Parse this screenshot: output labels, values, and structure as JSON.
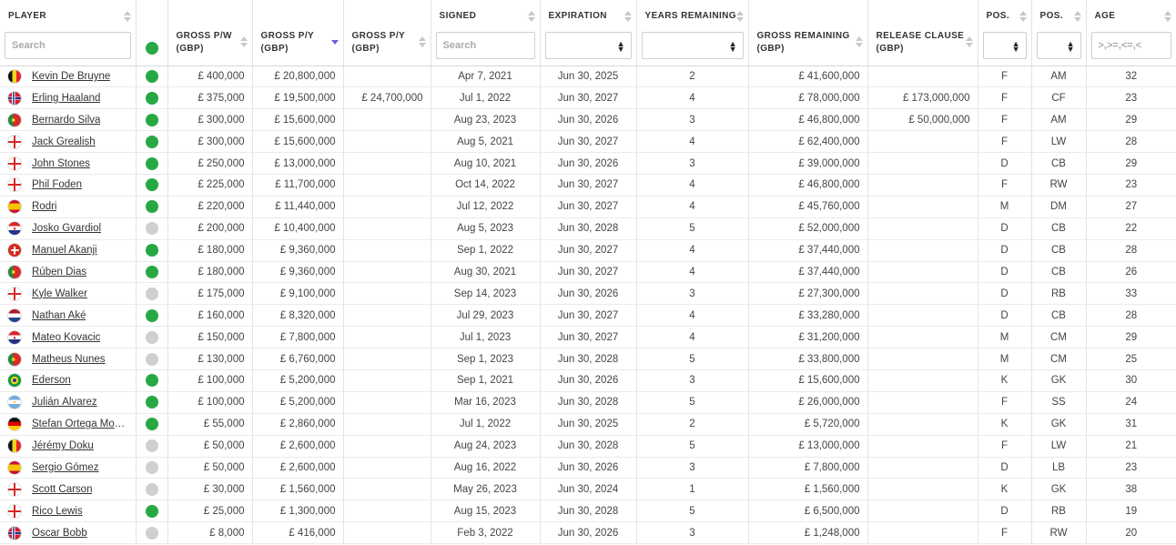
{
  "columns": {
    "player": "PLAYER",
    "gross_pw": "GROSS P/W\n(GBP)",
    "gross_py": "GROSS P/Y\n(GBP)",
    "gross_py2": "GROSS P/Y\n(GBP)",
    "signed": "SIGNED",
    "expiration": "EXPIRATION",
    "years_remaining": "YEARS REMAINING",
    "gross_remaining": "GROSS REMAINING\n(GBP)",
    "release_clause": "RELEASE CLAUSE\n(GBP)",
    "pos1": "POS.",
    "pos2": "POS.",
    "age": "AGE"
  },
  "filters": {
    "player_placeholder": "Search",
    "signed_placeholder": "Search",
    "age_placeholder": ">,>=,<=,<"
  },
  "colors": {
    "active_check": "#27a844",
    "inactive_check": "#cfcfcf",
    "sort_active": "#6d5fd6"
  },
  "sort": {
    "column": "gross_py",
    "direction": "descending"
  },
  "rows": [
    {
      "name": "Kevin De Bruyne",
      "flag": "belgium",
      "active": true,
      "pw": "£ 400,000",
      "py": "£ 20,800,000",
      "py2": "",
      "signed": "Apr 7, 2021",
      "exp": "Jun 30, 2025",
      "yrs": "2",
      "rem": "£ 41,600,000",
      "rc": "",
      "p1": "F",
      "p2": "AM",
      "age": "32"
    },
    {
      "name": "Erling Haaland",
      "flag": "norway",
      "active": true,
      "pw": "£ 375,000",
      "py": "£ 19,500,000",
      "py2": "£ 24,700,000",
      "signed": "Jul 1, 2022",
      "exp": "Jun 30, 2027",
      "yrs": "4",
      "rem": "£ 78,000,000",
      "rc": "£ 173,000,000",
      "p1": "F",
      "p2": "CF",
      "age": "23"
    },
    {
      "name": "Bernardo Silva",
      "flag": "portugal",
      "active": true,
      "pw": "£ 300,000",
      "py": "£ 15,600,000",
      "py2": "",
      "signed": "Aug 23, 2023",
      "exp": "Jun 30, 2026",
      "yrs": "3",
      "rem": "£ 46,800,000",
      "rc": "£ 50,000,000",
      "p1": "F",
      "p2": "AM",
      "age": "29"
    },
    {
      "name": "Jack Grealish",
      "flag": "england",
      "active": true,
      "pw": "£ 300,000",
      "py": "£ 15,600,000",
      "py2": "",
      "signed": "Aug 5, 2021",
      "exp": "Jun 30, 2027",
      "yrs": "4",
      "rem": "£ 62,400,000",
      "rc": "",
      "p1": "F",
      "p2": "LW",
      "age": "28"
    },
    {
      "name": "John Stones",
      "flag": "england",
      "active": true,
      "pw": "£ 250,000",
      "py": "£ 13,000,000",
      "py2": "",
      "signed": "Aug 10, 2021",
      "exp": "Jun 30, 2026",
      "yrs": "3",
      "rem": "£ 39,000,000",
      "rc": "",
      "p1": "D",
      "p2": "CB",
      "age": "29"
    },
    {
      "name": "Phil Foden",
      "flag": "england",
      "active": true,
      "pw": "£ 225,000",
      "py": "£ 11,700,000",
      "py2": "",
      "signed": "Oct 14, 2022",
      "exp": "Jun 30, 2027",
      "yrs": "4",
      "rem": "£ 46,800,000",
      "rc": "",
      "p1": "F",
      "p2": "RW",
      "age": "23"
    },
    {
      "name": "Rodri",
      "flag": "spain",
      "active": true,
      "pw": "£ 220,000",
      "py": "£ 11,440,000",
      "py2": "",
      "signed": "Jul 12, 2022",
      "exp": "Jun 30, 2027",
      "yrs": "4",
      "rem": "£ 45,760,000",
      "rc": "",
      "p1": "M",
      "p2": "DM",
      "age": "27"
    },
    {
      "name": "Josko Gvardiol",
      "flag": "croatia",
      "active": false,
      "pw": "£ 200,000",
      "py": "£ 10,400,000",
      "py2": "",
      "signed": "Aug 5, 2023",
      "exp": "Jun 30, 2028",
      "yrs": "5",
      "rem": "£ 52,000,000",
      "rc": "",
      "p1": "D",
      "p2": "CB",
      "age": "22"
    },
    {
      "name": "Manuel Akanji",
      "flag": "switzerland",
      "active": true,
      "pw": "£ 180,000",
      "py": "£ 9,360,000",
      "py2": "",
      "signed": "Sep 1, 2022",
      "exp": "Jun 30, 2027",
      "yrs": "4",
      "rem": "£ 37,440,000",
      "rc": "",
      "p1": "D",
      "p2": "CB",
      "age": "28"
    },
    {
      "name": "Rúben Dias",
      "flag": "portugal",
      "active": true,
      "pw": "£ 180,000",
      "py": "£ 9,360,000",
      "py2": "",
      "signed": "Aug 30, 2021",
      "exp": "Jun 30, 2027",
      "yrs": "4",
      "rem": "£ 37,440,000",
      "rc": "",
      "p1": "D",
      "p2": "CB",
      "age": "26"
    },
    {
      "name": "Kyle Walker",
      "flag": "england",
      "active": false,
      "pw": "£ 175,000",
      "py": "£ 9,100,000",
      "py2": "",
      "signed": "Sep 14, 2023",
      "exp": "Jun 30, 2026",
      "yrs": "3",
      "rem": "£ 27,300,000",
      "rc": "",
      "p1": "D",
      "p2": "RB",
      "age": "33"
    },
    {
      "name": "Nathan Aké",
      "flag": "netherlands",
      "active": true,
      "pw": "£ 160,000",
      "py": "£ 8,320,000",
      "py2": "",
      "signed": "Jul 29, 2023",
      "exp": "Jun 30, 2027",
      "yrs": "4",
      "rem": "£ 33,280,000",
      "rc": "",
      "p1": "D",
      "p2": "CB",
      "age": "28"
    },
    {
      "name": "Mateo Kovacic",
      "flag": "croatia",
      "active": false,
      "pw": "£ 150,000",
      "py": "£ 7,800,000",
      "py2": "",
      "signed": "Jul 1, 2023",
      "exp": "Jun 30, 2027",
      "yrs": "4",
      "rem": "£ 31,200,000",
      "rc": "",
      "p1": "M",
      "p2": "CM",
      "age": "29"
    },
    {
      "name": "Matheus Nunes",
      "flag": "portugal",
      "active": false,
      "pw": "£ 130,000",
      "py": "£ 6,760,000",
      "py2": "",
      "signed": "Sep 1, 2023",
      "exp": "Jun 30, 2028",
      "yrs": "5",
      "rem": "£ 33,800,000",
      "rc": "",
      "p1": "M",
      "p2": "CM",
      "age": "25"
    },
    {
      "name": "Ederson",
      "flag": "brazil",
      "active": true,
      "pw": "£ 100,000",
      "py": "£ 5,200,000",
      "py2": "",
      "signed": "Sep 1, 2021",
      "exp": "Jun 30, 2026",
      "yrs": "3",
      "rem": "£ 15,600,000",
      "rc": "",
      "p1": "K",
      "p2": "GK",
      "age": "30"
    },
    {
      "name": "Julián Álvarez",
      "flag": "argentina",
      "active": true,
      "pw": "£ 100,000",
      "py": "£ 5,200,000",
      "py2": "",
      "signed": "Mar 16, 2023",
      "exp": "Jun 30, 2028",
      "yrs": "5",
      "rem": "£ 26,000,000",
      "rc": "",
      "p1": "F",
      "p2": "SS",
      "age": "24"
    },
    {
      "name": "Stefan Ortega Mor…",
      "flag": "germany",
      "active": true,
      "pw": "£ 55,000",
      "py": "£ 2,860,000",
      "py2": "",
      "signed": "Jul 1, 2022",
      "exp": "Jun 30, 2025",
      "yrs": "2",
      "rem": "£ 5,720,000",
      "rc": "",
      "p1": "K",
      "p2": "GK",
      "age": "31"
    },
    {
      "name": "Jérémy Doku",
      "flag": "belgium",
      "active": false,
      "pw": "£ 50,000",
      "py": "£ 2,600,000",
      "py2": "",
      "signed": "Aug 24, 2023",
      "exp": "Jun 30, 2028",
      "yrs": "5",
      "rem": "£ 13,000,000",
      "rc": "",
      "p1": "F",
      "p2": "LW",
      "age": "21"
    },
    {
      "name": "Sergio Gómez",
      "flag": "spain",
      "active": false,
      "pw": "£ 50,000",
      "py": "£ 2,600,000",
      "py2": "",
      "signed": "Aug 16, 2022",
      "exp": "Jun 30, 2026",
      "yrs": "3",
      "rem": "£ 7,800,000",
      "rc": "",
      "p1": "D",
      "p2": "LB",
      "age": "23"
    },
    {
      "name": "Scott Carson",
      "flag": "england",
      "active": false,
      "pw": "£ 30,000",
      "py": "£ 1,560,000",
      "py2": "",
      "signed": "May 26, 2023",
      "exp": "Jun 30, 2024",
      "yrs": "1",
      "rem": "£ 1,560,000",
      "rc": "",
      "p1": "K",
      "p2": "GK",
      "age": "38"
    },
    {
      "name": "Rico Lewis",
      "flag": "england",
      "active": true,
      "pw": "£ 25,000",
      "py": "£ 1,300,000",
      "py2": "",
      "signed": "Aug 15, 2023",
      "exp": "Jun 30, 2028",
      "yrs": "5",
      "rem": "£ 6,500,000",
      "rc": "",
      "p1": "D",
      "p2": "RB",
      "age": "19"
    },
    {
      "name": "Oscar Bobb",
      "flag": "norway",
      "active": false,
      "pw": "£ 8,000",
      "py": "£ 416,000",
      "py2": "",
      "signed": "Feb 3, 2022",
      "exp": "Jun 30, 2026",
      "yrs": "3",
      "rem": "£ 1,248,000",
      "rc": "",
      "p1": "F",
      "p2": "RW",
      "age": "20"
    }
  ]
}
